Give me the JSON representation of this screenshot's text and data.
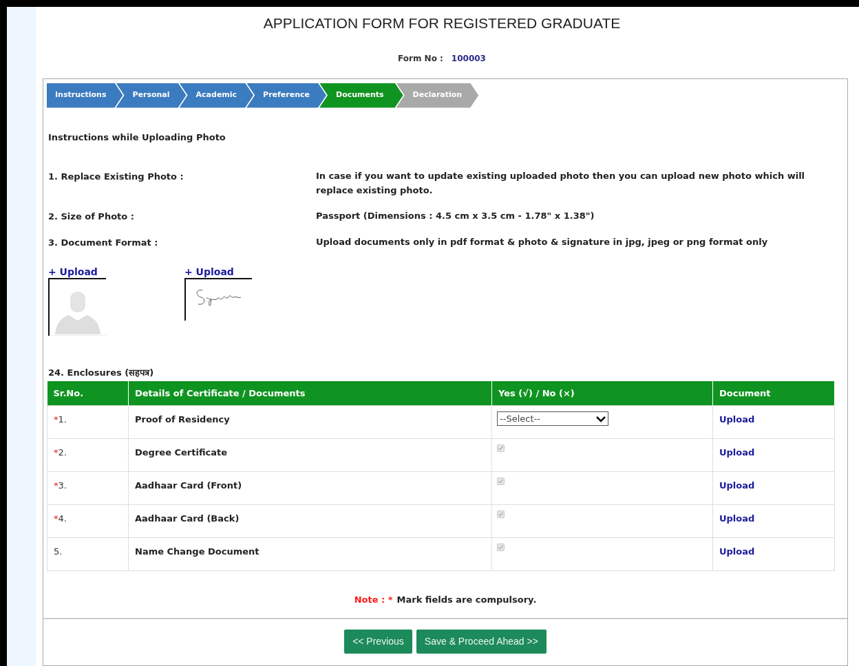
{
  "title": "APPLICATION FORM FOR REGISTERED GRADUATE",
  "form_no": {
    "label": "Form No :",
    "value": "100003"
  },
  "steps": [
    {
      "label": "Instructions",
      "completed": true,
      "selected": false
    },
    {
      "label": "Personal",
      "completed": true,
      "selected": false
    },
    {
      "label": "Academic",
      "completed": true,
      "selected": false
    },
    {
      "label": "Preference",
      "completed": true,
      "selected": false
    },
    {
      "label": "Documents",
      "completed": false,
      "selected": true
    },
    {
      "label": "Declaration",
      "completed": false,
      "selected": false
    }
  ],
  "instructions": {
    "heading": "Instructions while Uploading Photo",
    "items": [
      {
        "label": "1. Replace Existing Photo :",
        "text": "In case if you want to update existing uploaded photo then you can upload new photo which will replace existing photo."
      },
      {
        "label": "2. Size of Photo :",
        "text": "Passport (Dimensions : 4.5 cm x 3.5 cm - 1.78\" x 1.38\")"
      },
      {
        "label": "3. Document Format :",
        "text": "Upload documents only in pdf format & photo & signature in jpg, jpeg or png format only"
      }
    ]
  },
  "uploads": [
    {
      "link": "+ Upload"
    },
    {
      "link": "+ Upload",
      "kind": "signature"
    }
  ],
  "enclosures": {
    "heading": "24. Enclosures (सहपत्र)",
    "columns": [
      "Sr.No.",
      "Details of Certificate / Documents",
      "Yes (√) / No (×)",
      "Document"
    ],
    "rows": [
      {
        "sr": "1.",
        "marker": "*",
        "details": "Proof of Residency",
        "kind": "select",
        "value": "--Select--",
        "link": "Upload"
      },
      {
        "sr": "2.",
        "marker": "*",
        "details": "Degree Certificate",
        "kind": "checkbox",
        "checked": true,
        "disabled": true,
        "link": "Upload"
      },
      {
        "sr": "3.",
        "marker": "*",
        "details": "Aadhaar Card (Front)",
        "kind": "checkbox",
        "checked": true,
        "disabled": true,
        "link": "Upload"
      },
      {
        "sr": "4.",
        "marker": "*",
        "details": "Aadhaar Card (Back)",
        "kind": "checkbox",
        "checked": true,
        "disabled": true,
        "link": "Upload"
      },
      {
        "sr": "5.",
        "details": "Name Change Document",
        "kind": "checkbox",
        "checked": true,
        "disabled": true,
        "link": "Upload"
      }
    ]
  },
  "note": {
    "label": "Note : *",
    "text": "Mark fields are compulsory."
  },
  "buttons": [
    "<< Previous",
    "Save & Proceed Ahead >>"
  ]
}
